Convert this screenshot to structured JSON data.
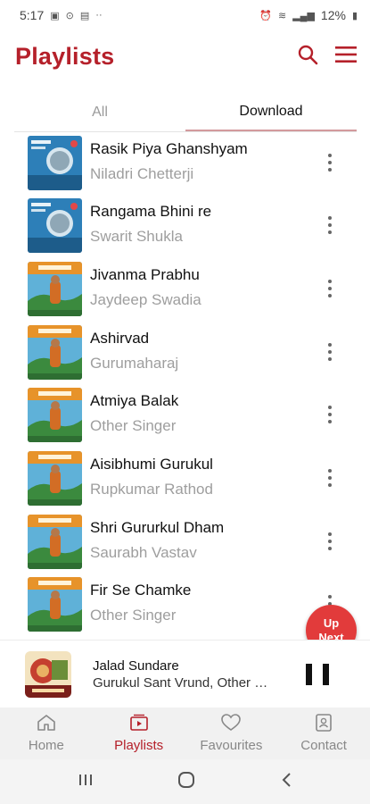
{
  "status_bar": {
    "time": "5:17",
    "battery": "12%"
  },
  "header": {
    "title": "Playlists"
  },
  "tabs": [
    {
      "label": "All",
      "active": false
    },
    {
      "label": "Download",
      "active": true
    }
  ],
  "songs": [
    {
      "title": "Rasik Piya Ghanshyam",
      "artist": "Niladri Chetterji",
      "art": "blue-album-art"
    },
    {
      "title": "Rangama Bhini re",
      "artist": "Swarit Shukla",
      "art": "blue-album-art"
    },
    {
      "title": "Jivanma Prabhu",
      "artist": "Jaydeep Swadia",
      "art": "landscape-album-art"
    },
    {
      "title": "Ashirvad",
      "artist": "Gurumaharaj",
      "art": "landscape-album-art"
    },
    {
      "title": "Atmiya Balak",
      "artist": "Other Singer",
      "art": "landscape-album-art"
    },
    {
      "title": "Aisibhumi Gurukul",
      "artist": "Rupkumar Rathod",
      "art": "landscape-album-art"
    },
    {
      "title": "Shri Gururkul Dham",
      "artist": "Saurabh Vastav",
      "art": "landscape-album-art"
    },
    {
      "title": "Fir Se Chamke",
      "artist": "Other Singer",
      "art": "landscape-album-art"
    }
  ],
  "up_next": {
    "line1": "Up",
    "line2": "Next"
  },
  "now_playing": {
    "title": "Jalad Sundare",
    "subtitle": "Gurukul Sant Vrund, Other Singer"
  },
  "bottom_nav": [
    {
      "label": "Home",
      "icon": "home-icon",
      "active": false
    },
    {
      "label": "Playlists",
      "icon": "playlist-icon",
      "active": true
    },
    {
      "label": "Favourites",
      "icon": "heart-icon",
      "active": false
    },
    {
      "label": "Contact",
      "icon": "contact-icon",
      "active": false
    }
  ],
  "colors": {
    "accent": "#b5202a",
    "up_next_bg": "#e23b3b",
    "nav_bg": "#f1f1f1"
  }
}
